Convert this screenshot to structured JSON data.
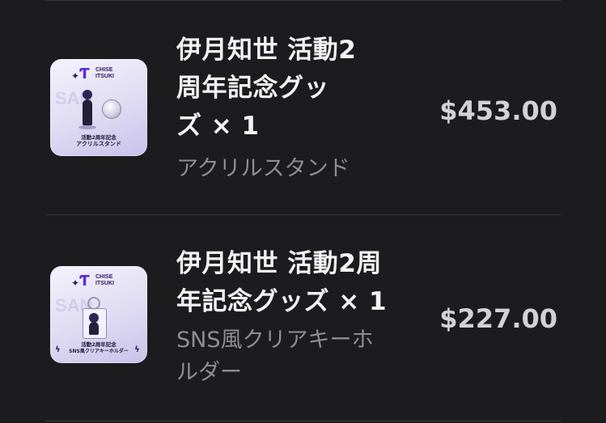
{
  "order_items": [
    {
      "title_lines": [
        "伊月知世 活動2",
        "周年記念グッ",
        "ズ × 1"
      ],
      "variant": "アクリルスタンド",
      "price": "$453.00",
      "thumbnail": {
        "logo_mark": "Ƭ",
        "logo_line1": "CHISE",
        "logo_line2": "ITSUKI",
        "bg_text": "SAN",
        "caption_line1": "活動2周年記念",
        "caption_line2": "アクリルスタンド"
      }
    },
    {
      "title_lines": [
        "伊月知世 活動2周",
        "年記念グッズ × 1"
      ],
      "variant_lines": [
        "SNS風クリアキーホ",
        "ルダー"
      ],
      "price": "$227.00",
      "thumbnail": {
        "logo_mark": "Ƭ",
        "logo_line1": "CHISE",
        "logo_line2": "ITSUKI",
        "bg_text": "SAN",
        "caption_line1": "活動2周年記念",
        "caption_line2": "SNS風クリアキーホルダー"
      }
    }
  ],
  "colors": {
    "background": "#1c1c1e",
    "divider": "#3a3a3c",
    "title_text": "#f2f2f7",
    "secondary_text": "#8e8e93",
    "price_text": "#d1d1d6",
    "thumb_accent": "#5a2ad6"
  }
}
